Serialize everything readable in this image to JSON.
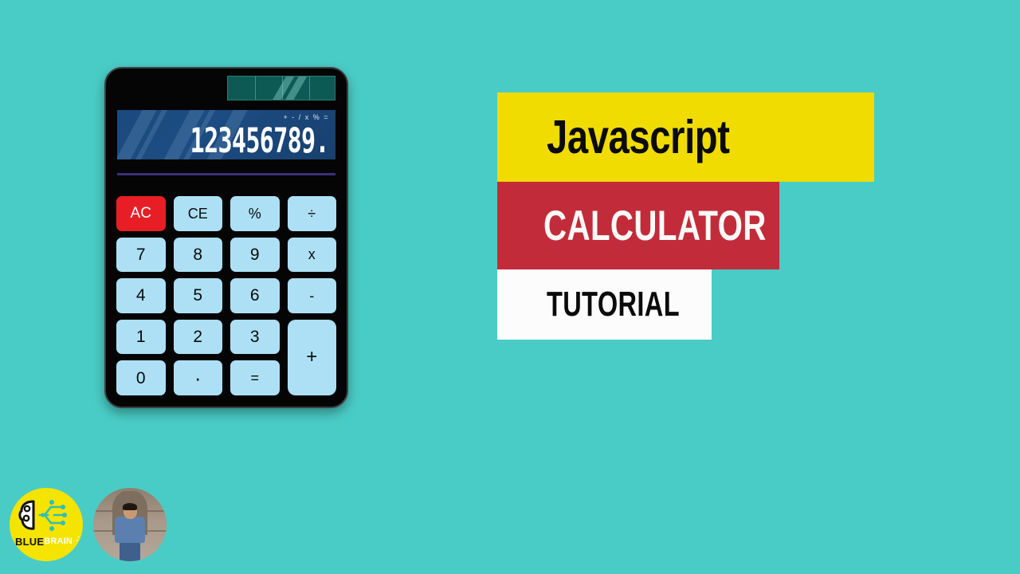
{
  "background_color": "#4ACCC6",
  "calculator": {
    "name": "desktop-calculator",
    "body_color": "#050506",
    "solar_panel": {
      "color": "#0d5a54",
      "cells": 4
    },
    "display": {
      "value": "123456789.",
      "operators_hint": "+ - / x % =",
      "background_color": "#1b4a7e",
      "text_color": "#ffffff"
    },
    "underline_color": "#3b2f7a",
    "key_color": "#ADE0F5",
    "key_text_color": "#0a0a0a",
    "clear_all_color": "#E81E26",
    "keys": [
      {
        "label": "AC",
        "name": "key-clear-all",
        "kind": "clear-all"
      },
      {
        "label": "CE",
        "name": "key-clear-entry",
        "kind": "small"
      },
      {
        "label": "%",
        "name": "key-percent",
        "kind": "small"
      },
      {
        "label": "÷",
        "name": "key-divide",
        "kind": "small"
      },
      {
        "label": "7",
        "name": "key-7",
        "kind": "digit"
      },
      {
        "label": "8",
        "name": "key-8",
        "kind": "digit"
      },
      {
        "label": "9",
        "name": "key-9",
        "kind": "digit"
      },
      {
        "label": "x",
        "name": "key-multiply",
        "kind": "small"
      },
      {
        "label": "4",
        "name": "key-4",
        "kind": "digit"
      },
      {
        "label": "5",
        "name": "key-5",
        "kind": "digit"
      },
      {
        "label": "6",
        "name": "key-6",
        "kind": "digit"
      },
      {
        "label": "-",
        "name": "key-subtract",
        "kind": "small"
      },
      {
        "label": "1",
        "name": "key-1",
        "kind": "digit"
      },
      {
        "label": "2",
        "name": "key-2",
        "kind": "digit"
      },
      {
        "label": "3",
        "name": "key-3",
        "kind": "digit"
      },
      {
        "label": "+",
        "name": "key-add",
        "kind": "plus"
      },
      {
        "label": "0",
        "name": "key-0",
        "kind": "digit"
      },
      {
        "label": "·",
        "name": "key-decimal",
        "kind": "dot"
      },
      {
        "label": "=",
        "name": "key-equals",
        "kind": "small"
      }
    ]
  },
  "banners": {
    "language": {
      "text": "Javascript",
      "background": "#F0DC00",
      "text_color": "#0b0b0b"
    },
    "subject": {
      "text": "CALCULATOR",
      "background": "#C22C3A",
      "text_color": "#FAFAF7"
    },
    "type": {
      "text": "TUTORIAL",
      "background": "#FCFCFC",
      "text_color": "#0b0b0b"
    }
  },
  "branding": {
    "logo": {
      "name": "blue-brain-logo",
      "background": "#F5E400",
      "wordmark_primary": "BLUE",
      "wordmark_secondary": "BRAIN",
      "icons": [
        "brain-circuit-icon",
        "lightbulb-icon"
      ]
    },
    "presenter": {
      "name": "presenter-avatar"
    }
  }
}
